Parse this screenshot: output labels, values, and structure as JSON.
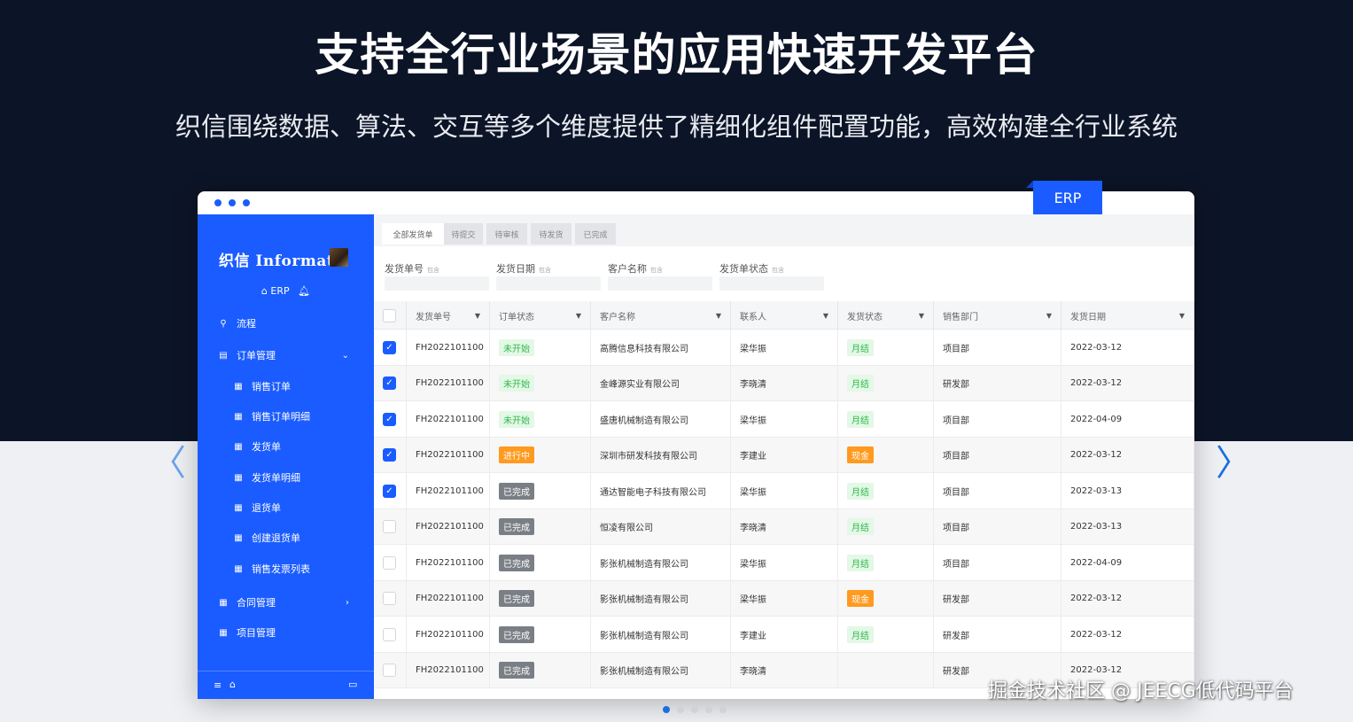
{
  "hero": {
    "title": "支持全行业场景的应用快速开发平台",
    "subtitle": "织信围绕数据、算法、交互等多个维度提供了精细化组件配置功能，高效构建全行业系统"
  },
  "erp_tag": "ERP",
  "sidebar": {
    "logo": "织信 Informat",
    "app": "ERP",
    "items": [
      {
        "label": "流程",
        "icon": "user-icon"
      },
      {
        "label": "订单管理",
        "icon": "list-icon",
        "expanded": true
      },
      {
        "label": "销售订单",
        "icon": "table-icon"
      },
      {
        "label": "销售订单明细",
        "icon": "table-icon"
      },
      {
        "label": "发货单",
        "icon": "table-icon"
      },
      {
        "label": "发货单明细",
        "icon": "table-icon"
      },
      {
        "label": "退货单",
        "icon": "table-icon"
      },
      {
        "label": "创建退货单",
        "icon": "table-icon"
      },
      {
        "label": "销售发票列表",
        "icon": "table-icon"
      },
      {
        "label": "合同管理",
        "icon": "table-icon"
      },
      {
        "label": "项目管理",
        "icon": "table-icon"
      }
    ]
  },
  "tabs": [
    "全部发货单",
    "待提交",
    "待审核",
    "待发货",
    "已完成"
  ],
  "filters": [
    {
      "label": "发货单号",
      "op": "包含"
    },
    {
      "label": "发货日期",
      "op": "包含"
    },
    {
      "label": "客户名称",
      "op": "包含"
    },
    {
      "label": "发货单状态",
      "op": "包含"
    }
  ],
  "columns": [
    "发货单号",
    "订单状态",
    "客户名称",
    "联系人",
    "发货状态",
    "销售部门",
    "发货日期"
  ],
  "status_colors": {
    "未开始": {
      "bg": "#e3f8e6",
      "fg": "#2fb84a"
    },
    "进行中": {
      "bg": "#ff9a1f",
      "fg": "#ffffff"
    },
    "已完成": {
      "bg": "#7a7f86",
      "fg": "#ffffff"
    },
    "月结": {
      "bg": "#e3f8e6",
      "fg": "#2fb84a"
    },
    "现金": {
      "bg": "#ff9a1f",
      "fg": "#ffffff"
    }
  },
  "rows": [
    {
      "checked": true,
      "no": "FH2022101100",
      "status": "未开始",
      "customer": "高腾信息科技有限公司",
      "contact": "梁华振",
      "ship": "月结",
      "dept": "项目部",
      "date": "2022-03-12"
    },
    {
      "checked": true,
      "no": "FH2022101100",
      "status": "未开始",
      "customer": "金峰源实业有限公司",
      "contact": "李晓清",
      "ship": "月结",
      "dept": "研发部",
      "date": "2022-03-12"
    },
    {
      "checked": true,
      "no": "FH2022101100",
      "status": "未开始",
      "customer": "盛唐机械制造有限公司",
      "contact": "梁华振",
      "ship": "月结",
      "dept": "项目部",
      "date": "2022-04-09"
    },
    {
      "checked": true,
      "no": "FH2022101100",
      "status": "进行中",
      "customer": "深圳市研发科技有限公司",
      "contact": "李建业",
      "ship": "现金",
      "dept": "项目部",
      "date": "2022-03-12"
    },
    {
      "checked": true,
      "no": "FH2022101100",
      "status": "已完成",
      "customer": "通达智能电子科技有限公司",
      "contact": "梁华振",
      "ship": "月结",
      "dept": "项目部",
      "date": "2022-03-13"
    },
    {
      "checked": false,
      "no": "FH2022101100",
      "status": "已完成",
      "customer": "恒凌有限公司",
      "contact": "李晓清",
      "ship": "月结",
      "dept": "项目部",
      "date": "2022-03-13"
    },
    {
      "checked": false,
      "no": "FH2022101100",
      "status": "已完成",
      "customer": "影张机械制造有限公司",
      "contact": "梁华振",
      "ship": "月结",
      "dept": "项目部",
      "date": "2022-04-09"
    },
    {
      "checked": false,
      "no": "FH2022101100",
      "status": "已完成",
      "customer": "影张机械制造有限公司",
      "contact": "梁华振",
      "ship": "现金",
      "dept": "研发部",
      "date": "2022-03-12"
    },
    {
      "checked": false,
      "no": "FH2022101100",
      "status": "已完成",
      "customer": "影张机械制造有限公司",
      "contact": "李建业",
      "ship": "月结",
      "dept": "研发部",
      "date": "2022-03-12"
    },
    {
      "checked": false,
      "no": "FH2022101100",
      "status": "已完成",
      "customer": "影张机械制造有限公司",
      "contact": "李晓清",
      "ship": "",
      "dept": "研发部",
      "date": "2022-03-12"
    }
  ],
  "carousel": {
    "count": 5,
    "active": 0
  },
  "watermark": "掘金技术社区 @ JEECG低代码平台"
}
